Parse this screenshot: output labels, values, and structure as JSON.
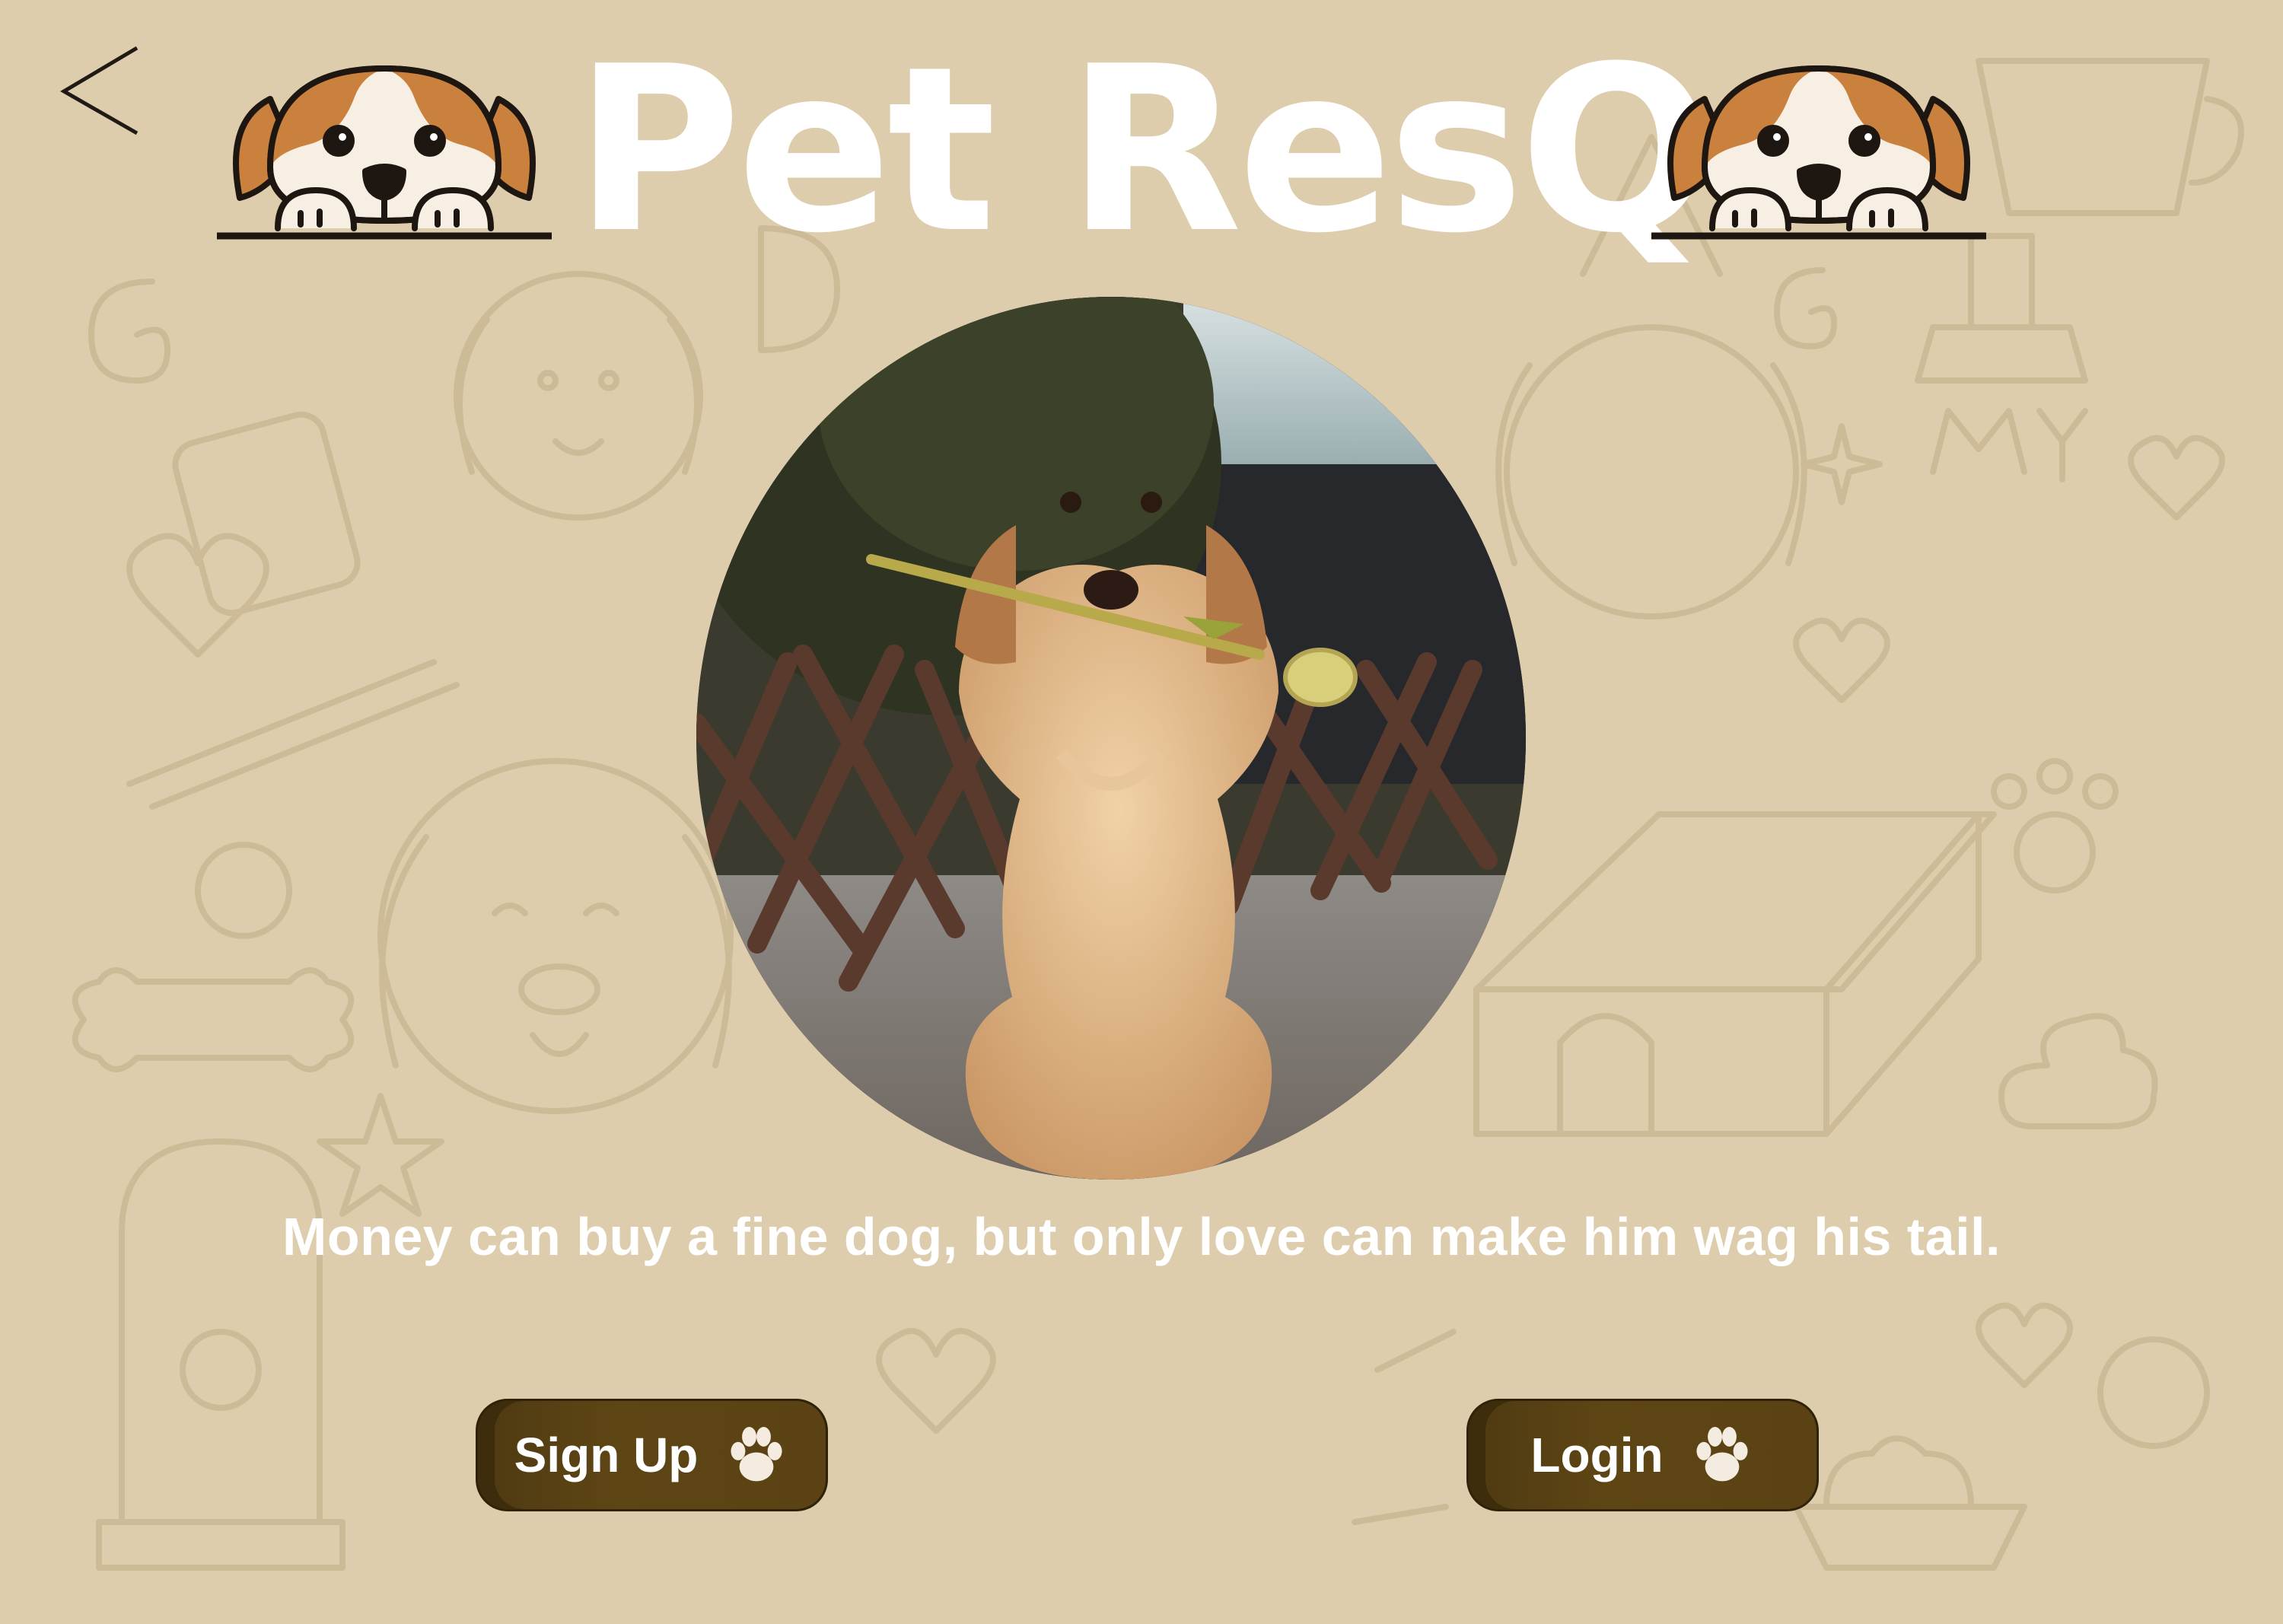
{
  "header": {
    "title": "Pet ResQ",
    "back_icon": "chevron-left-icon",
    "mascot_icon": "puppy-peeking-icon"
  },
  "hero": {
    "image": "golden-retriever-puppy-with-tulip"
  },
  "tagline": "Money can buy a fine dog, but only love can make him wag his tail.",
  "actions": {
    "signup_label": "Sign Up",
    "login_label": "Login",
    "button_icon": "paw-icon"
  },
  "colors": {
    "background": "#ddcdad",
    "button": "#5a4214",
    "text": "#ffffff"
  }
}
